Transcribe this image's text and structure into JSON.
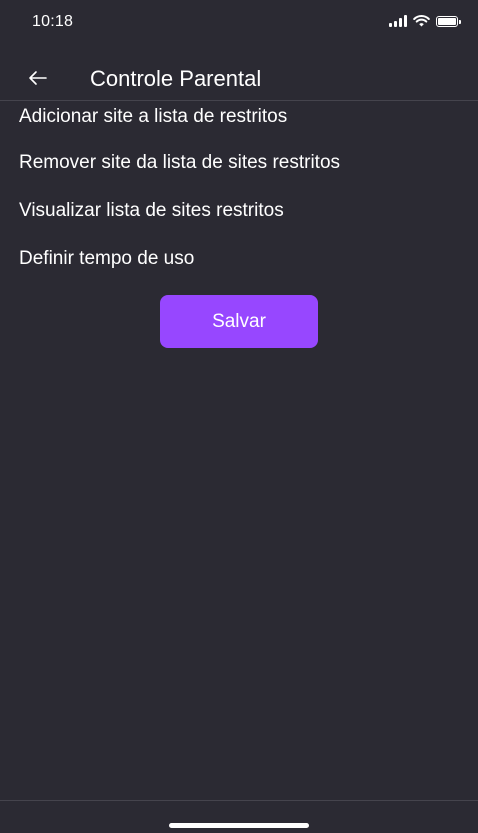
{
  "status_bar": {
    "time": "10:18",
    "icons": [
      "signal-icon",
      "wifi-icon",
      "battery-icon"
    ]
  },
  "header": {
    "back_icon": "arrow-left-icon",
    "title": "Controle Parental"
  },
  "menu": {
    "items": [
      {
        "label": "Adicionar site a lista de restritos"
      },
      {
        "label": "Remover site da lista de sites restritos"
      },
      {
        "label": "Visualizar lista de sites restritos"
      },
      {
        "label": "Definir tempo de uso"
      }
    ]
  },
  "actions": {
    "save_label": "Salvar"
  },
  "colors": {
    "background": "#2b2a33",
    "accent": "#9747ff",
    "text": "#ffffff",
    "divider": "#45444d"
  }
}
